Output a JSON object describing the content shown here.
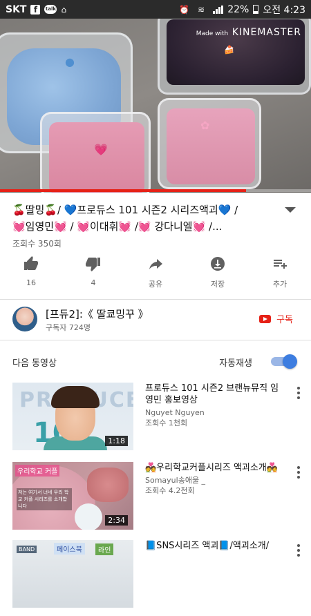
{
  "status_bar": {
    "carrier": "SKT",
    "battery": "22%",
    "time": "오전 4:23",
    "icons": [
      "facebook-icon",
      "talk-icon",
      "home-app-icon",
      "alarm-icon",
      "wifi-icon",
      "signal-icon",
      "battery-icon"
    ]
  },
  "video": {
    "watermark_small": "Made with",
    "watermark_brand": "KINEMASTER",
    "progress": 0.79,
    "progress_color": "#e62117"
  },
  "title": {
    "line1": "🍒딸밍🍒/ 💙프로듀스 101 시즌2 시리즈액괴💙 /",
    "line2": "💓임영민💓 / 💓이대휘💓 /💓 강다니엘💓 /...",
    "views": "조회수 350회"
  },
  "actions": [
    {
      "icon": "thumbs-up-icon",
      "label": "16"
    },
    {
      "icon": "thumbs-down-icon",
      "label": "4"
    },
    {
      "icon": "share-icon",
      "label": "공유"
    },
    {
      "icon": "download-icon",
      "label": "저장"
    },
    {
      "icon": "add-to-playlist-icon",
      "label": "추가"
    }
  ],
  "channel": {
    "name": "[프듀2]:《 딸쿄밍꾸 》",
    "subscribers": "구독자 724명",
    "subscribe_label": "구독"
  },
  "up_next": {
    "label": "다음 동영상",
    "autoplay_label": "자동재생",
    "autoplay_on": true
  },
  "list": [
    {
      "title": "프로듀스 101 시즌2 브랜뉴뮤직 임영민 홍보영상",
      "channel": "Nguyet Nguyen",
      "views": "조회수 1천회",
      "duration": "1:18",
      "thumb_text": "PRODUCE",
      "thumb_num": "101"
    },
    {
      "title": "💑우리학교커플시리즈 액괴소개💑",
      "channel": "Somayul송애울 _",
      "views": "조회수 4.2천회",
      "duration": "2:34",
      "thumb_label1": "우리학교 커플",
      "thumb_label2": "저는 여기서 너네 우리 학교 커플 시리즈를 소개합니다"
    },
    {
      "title": "📘SNS시리즈 액괴📘/액괴소개/",
      "channel": "",
      "views": "",
      "duration": "",
      "thumb_a": "BAND",
      "thumb_b": "페이스북",
      "thumb_c": "라인"
    }
  ]
}
